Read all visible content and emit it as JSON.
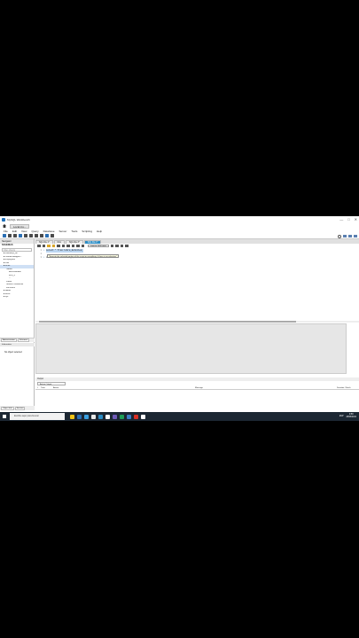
{
  "window": {
    "title": "MySQL Workbench",
    "controls": [
      "—",
      "□",
      "✕"
    ]
  },
  "connection_tab": {
    "label": "Local ins..."
  },
  "menu": [
    "File",
    "Edit",
    "View",
    "Query",
    "Database",
    "Server",
    "Tools",
    "Scripting",
    "Help"
  ],
  "sidebar": {
    "header": "Navigator",
    "subheader": "SCHEMAS",
    "filter_placeholder": "Filter objects",
    "schemas": [
      {
        "label": "bootcamp_db",
        "level": 1,
        "selected": false
      },
      {
        "label": "coursemanagem...",
        "level": 1,
        "selected": false
      },
      {
        "label": "employees",
        "level": 1,
        "selected": false
      },
      {
        "label": "ruta",
        "level": 1,
        "selected": false
      },
      {
        "label": "libros",
        "level": 1,
        "selected": true
      },
      {
        "label": "Tables",
        "level": 2,
        "selected": false
      },
      {
        "label": "administrador",
        "level": 3,
        "selected": false
      },
      {
        "label": "libro_1",
        "level": 3,
        "selected": false
      },
      {
        "label": "...",
        "level": 3,
        "selected": false
      },
      {
        "label": "Views",
        "level": 2,
        "selected": false
      },
      {
        "label": "Stored Procedures",
        "level": 2,
        "selected": false
      },
      {
        "label": "Functions",
        "level": 2,
        "selected": false
      },
      {
        "label": "sakila",
        "level": 1,
        "selected": false
      },
      {
        "label": "world",
        "level": 1,
        "selected": false
      },
      {
        "label": "sys",
        "level": 1,
        "selected": false
      }
    ],
    "tabs": [
      "Administration",
      "Schemas"
    ],
    "info_header": "Information",
    "no_object": "No object selected",
    "bottom_tabs": [
      "Object Info",
      "Session"
    ]
  },
  "editor": {
    "tabs": [
      {
        "label": "SQL File 1*",
        "active": false
      },
      {
        "label": "libro",
        "active": false
      },
      {
        "label": "SQL File 3*",
        "active": false
      },
      {
        "label": "SQL File 4*",
        "active": true
      }
    ],
    "limit": "Limit to 1000 rows",
    "lines": [
      {
        "num": "1",
        "code": "select * from libro_detalles;",
        "highlight": true
      },
      {
        "num": "2",
        "code": "",
        "highlight": false
      },
      {
        "num": "3",
        "code": "select * from libro_1;",
        "highlight": false
      }
    ],
    "tooltip": "\"Execute the selected portion of the script or everything, if there is no selection\""
  },
  "results": {
    "caption": "",
    "side_label": ""
  },
  "output": {
    "header": "Output",
    "select_value": "Action Output",
    "columns": [
      "#",
      "Time",
      "Action",
      "Message",
      "Duration / Fetch"
    ]
  },
  "taskbar": {
    "search_placeholder": "Escribe aquí para buscar",
    "icon_colors": [
      "#f0c419",
      "#2b6fb4",
      "#3aa0e0",
      "#e8e8e8",
      "#2b8cc4",
      "#ffffff",
      "#6f5bb7",
      "#1f9e57",
      "#3c7dc4",
      "#d93025",
      "#ffffff"
    ],
    "tray_lang": "ESP",
    "time": "9:58",
    "date": "28/06/2021"
  },
  "colors": {
    "accent": "#2b8cc4",
    "selection": "#bcd6f1",
    "taskbar": "#1c2733"
  }
}
